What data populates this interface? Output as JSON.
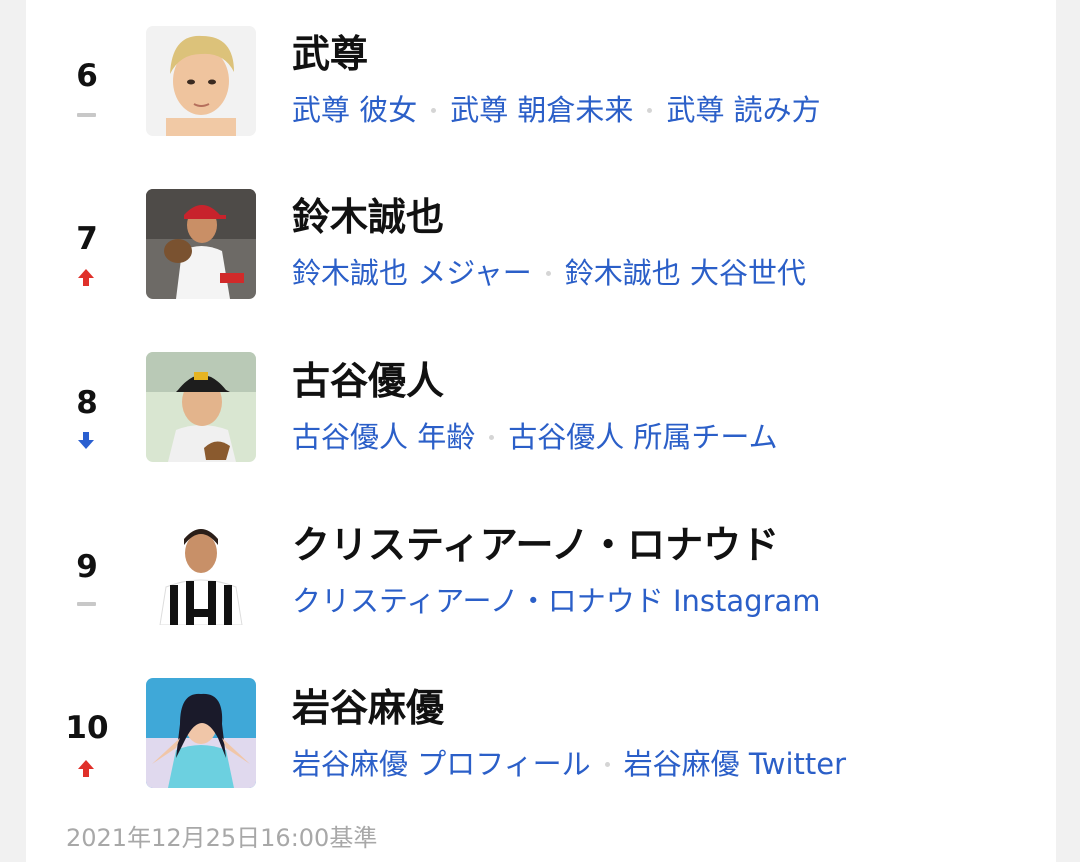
{
  "ranking": [
    {
      "rank": "6",
      "change": "same",
      "name": "武尊",
      "related": [
        "武尊 彼女",
        "武尊 朝倉未来",
        "武尊 読み方"
      ]
    },
    {
      "rank": "7",
      "change": "up",
      "name": "鈴木誠也",
      "related": [
        "鈴木誠也 メジャー",
        "鈴木誠也 大谷世代"
      ]
    },
    {
      "rank": "8",
      "change": "down",
      "name": "古谷優人",
      "related": [
        "古谷優人 年齢",
        "古谷優人 所属チーム"
      ]
    },
    {
      "rank": "9",
      "change": "same",
      "name": "クリスティアーノ・ロナウド",
      "related": [
        "クリスティアーノ・ロナウド Instagram"
      ]
    },
    {
      "rank": "10",
      "change": "up",
      "name": "岩谷麻優",
      "related": [
        "岩谷麻優 プロフィール",
        "岩谷麻優 Twitter"
      ]
    }
  ],
  "colors": {
    "up": "#e0302a",
    "down": "#2a5fd0",
    "same": "#c8c8c8",
    "link": "#2b5fc8"
  },
  "footer": {
    "timestamp": "2021年12月25日16:00基準"
  }
}
